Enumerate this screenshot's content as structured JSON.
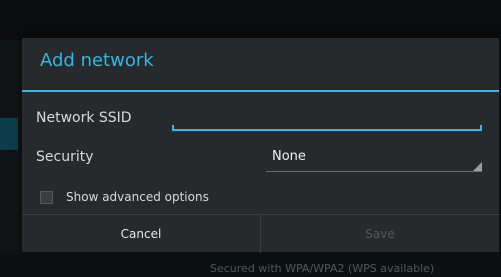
{
  "dialog": {
    "title": "Add network",
    "ssid_label": "Network SSID",
    "ssid_value": "",
    "security_label": "Security",
    "security_value": "None",
    "advanced_label": "Show advanced options",
    "advanced_checked": false,
    "cancel_label": "Cancel",
    "save_label": "Save"
  },
  "background": {
    "footer_text": "Secured with WPA/WPA2 (WPS available)"
  },
  "colors": {
    "accent": "#33b5e5",
    "dialog_bg": "#262a2d",
    "disabled_text": "#565a5d"
  }
}
